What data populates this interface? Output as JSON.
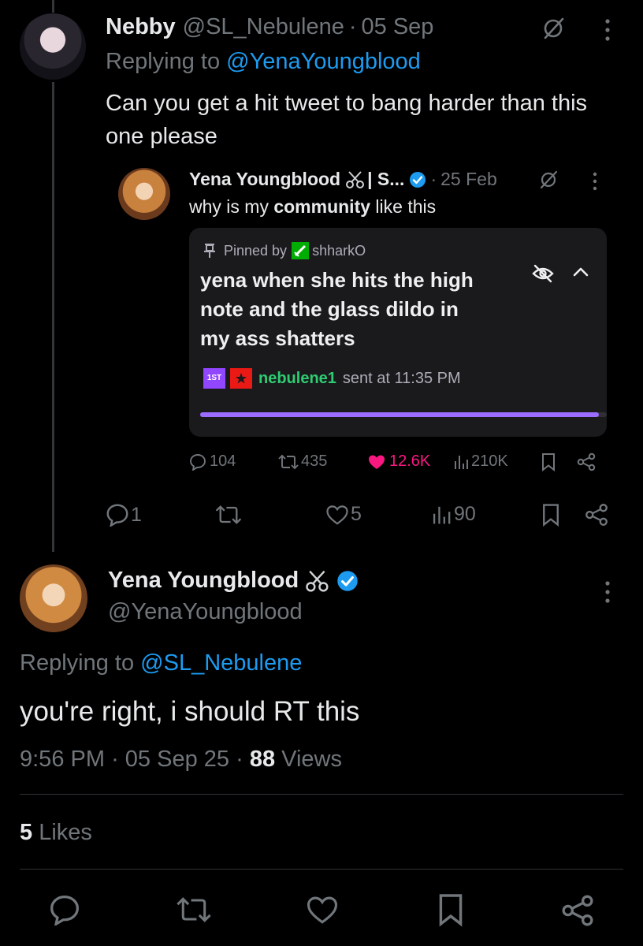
{
  "reply_tweet": {
    "display_name": "Nebby",
    "handle": "@SL_Nebulene",
    "separator": "·",
    "date": "05 Sep",
    "replying_prefix": "Replying to ",
    "replying_to": "@YenaYoungblood",
    "text": "Can you get a hit tweet to bang harder than this one please",
    "actions": {
      "replies": "1",
      "reposts": "",
      "likes": "5",
      "views": "90"
    }
  },
  "quoted_tweet": {
    "display_name": "Yena Youngblood",
    "name_suffix": "| S...",
    "separator": "·",
    "date": "25 Feb",
    "text_before": "why is my ",
    "text_bold": "community",
    "text_after": " like this",
    "pinned": {
      "pinned_by_label": "Pinned by",
      "pinned_by_user": "shharkO",
      "message": "yena when she hits the high note and the glass dildo in my ass shatters",
      "badge_1st": "1ST",
      "sender": "nebulene1",
      "sent_at": "sent at 11:35 PM",
      "progress": 0.98
    },
    "actions": {
      "replies": "104",
      "reposts": "435",
      "likes": "12.6K",
      "views": "210K"
    }
  },
  "main_tweet": {
    "display_name": "Yena Youngblood",
    "handle": "@YenaYoungblood",
    "replying_prefix": "Replying to ",
    "replying_to": "@SL_Nebulene",
    "text": "you're right, i should RT this",
    "time": "9:56 PM",
    "separator": "·",
    "date": "05 Sep 25",
    "views_count": "88",
    "views_label": " Views",
    "likes_count": "5",
    "likes_label": " Likes"
  },
  "colors": {
    "background": "#000000",
    "text": "#e7e9ea",
    "secondary": "#71767b",
    "link": "#1d9bf0",
    "like_active": "#f91880",
    "progress": "#9c6cff",
    "pinned_user": "#2ecc71"
  },
  "icons": [
    "grok-slash-icon",
    "more-icon",
    "verified-badge-icon",
    "reply-icon",
    "repost-icon",
    "like-icon",
    "views-icon",
    "bookmark-icon",
    "share-icon",
    "pin-icon",
    "hide-icon",
    "chevron-up-icon"
  ]
}
